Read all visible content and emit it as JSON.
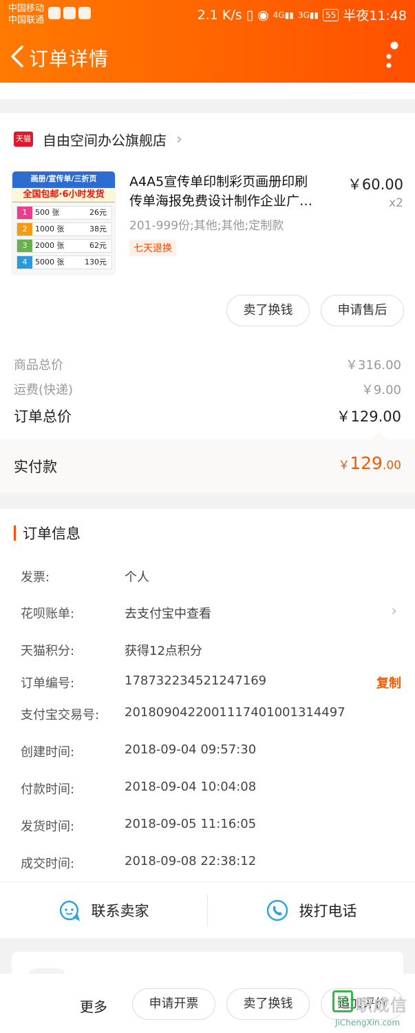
{
  "status_bar": {
    "carrier1": "中国移动",
    "carrier2": "中国联通",
    "speed": "2.1 K/s",
    "battery": "55",
    "time": "半夜11:48"
  },
  "header": {
    "title": "订单详情",
    "back_icon": "back-arrow-icon",
    "more_icon": "more-dots-icon"
  },
  "shop": {
    "badge": "天猫",
    "name": "自由空间办公旗舰店"
  },
  "product": {
    "title_line1": "A4A5宣传单印制彩页画册印刷",
    "title_line2": "传单海报免费设计制作企业广…",
    "price": "￥60.00",
    "qty": "x2",
    "spec": "201-999份;其他;其他;定制款",
    "tag": "七天退换",
    "image": {
      "top": "画册/宣传单/三折页",
      "sub": "全国包邮·6小时发货",
      "rows": [
        {
          "n": "1",
          "qty": "500 张",
          "price": "26元",
          "color": "#e83e8c"
        },
        {
          "n": "2",
          "qty": "1000 张",
          "price": "38元",
          "color": "#f39c12"
        },
        {
          "n": "3",
          "qty": "2000 张",
          "price": "62元",
          "color": "#6ab04c"
        },
        {
          "n": "4",
          "qty": "5000 张",
          "price": "130元",
          "color": "#2d98da"
        }
      ]
    }
  },
  "item_actions": {
    "sell": "卖了换钱",
    "after_sale": "申请售后"
  },
  "summary": {
    "goods_label": "商品总价",
    "goods_value": "￥316.00",
    "ship_label": "运费(快递)",
    "ship_value": "￥9.00",
    "total_label": "订单总价",
    "total_value": "￥129.00"
  },
  "paid": {
    "label": "实付款",
    "currency": "￥",
    "integer": "129",
    "decimal": ".00"
  },
  "order_info": {
    "title": "订单信息",
    "rows": [
      {
        "k": "发票:",
        "v": "个人"
      },
      {
        "k": "花呗账单:",
        "v": "去支付宝中查看"
      },
      {
        "k": "天猫积分:",
        "v": "获得12点积分"
      },
      {
        "k": "订单编号:",
        "v": "178732234521247169",
        "action": "复制"
      },
      {
        "k": "支付宝交易号:",
        "v": "2018090422001117401001314497"
      },
      {
        "k": "创建时间:",
        "v": "2018-09-04 09:57:30"
      },
      {
        "k": "付款时间:",
        "v": "2018-09-04 10:04:08"
      },
      {
        "k": "发货时间:",
        "v": "2018-09-05 11:16:05"
      },
      {
        "k": "成交时间:",
        "v": "2018-09-08 22:38:12"
      }
    ]
  },
  "contact": {
    "seller": "联系卖家",
    "phone": "拨打电话"
  },
  "bottom_bar": {
    "more": "更多",
    "invoice": "申请开票",
    "sell": "卖了换钱",
    "review": "追加评价"
  },
  "watermark": {
    "logo": "园",
    "text": "职成信",
    "url": "JiChengXin.com"
  },
  "colors": {
    "brand_orange": "#ff5000",
    "price_orange": "#f35b00",
    "tmall_red": "#e4162b"
  }
}
